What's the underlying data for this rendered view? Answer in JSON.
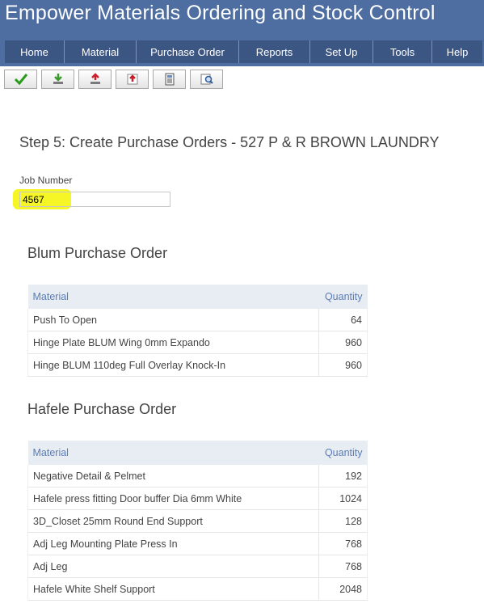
{
  "app": {
    "title": "Empower  Materials Ordering and Stock Control"
  },
  "nav": [
    {
      "label": "Home"
    },
    {
      "label": "Material"
    },
    {
      "label": "Purchase Order"
    },
    {
      "label": "Reports"
    },
    {
      "label": "Set Up"
    },
    {
      "label": "Tools"
    },
    {
      "label": "Help"
    }
  ],
  "toolbar": [
    {
      "icon": "checkmark-icon"
    },
    {
      "icon": "download-icon"
    },
    {
      "icon": "upload-icon"
    },
    {
      "icon": "export-icon"
    },
    {
      "icon": "calculator-icon"
    },
    {
      "icon": "preview-icon"
    }
  ],
  "page": {
    "step_title": "Step 5: Create Purchase Orders - 527 P & R BROWN LAUNDRY"
  },
  "job": {
    "label": "Job Number",
    "value": "4567"
  },
  "orders": [
    {
      "title": "Blum Purchase Order",
      "headers": {
        "material": "Material",
        "quantity": "Quantity"
      },
      "rows": [
        {
          "material": "Push To Open",
          "quantity": "64"
        },
        {
          "material": "Hinge Plate BLUM Wing 0mm Expando",
          "quantity": "960"
        },
        {
          "material": "Hinge BLUM 110deg Full Overlay Knock-In",
          "quantity": "960"
        }
      ]
    },
    {
      "title": "Hafele Purchase Order",
      "headers": {
        "material": "Material",
        "quantity": "Quantity"
      },
      "rows": [
        {
          "material": "Negative Detail & Pelmet",
          "quantity": "192"
        },
        {
          "material": "Hafele press fitting Door buffer Dia 6mm White",
          "quantity": "1024"
        },
        {
          "material": "3D_Closet 25mm Round End Support",
          "quantity": "128"
        },
        {
          "material": "Adj Leg Mounting Plate Press In",
          "quantity": "768"
        },
        {
          "material": "Adj Leg",
          "quantity": "768"
        },
        {
          "material": "Hafele White Shelf Support",
          "quantity": "2048"
        }
      ]
    }
  ],
  "colors": {
    "header_bg": "#4e6ea2",
    "nav_bg": "#3c5683",
    "highlight": "#f4f400",
    "table_header_text": "#5a7db5"
  }
}
